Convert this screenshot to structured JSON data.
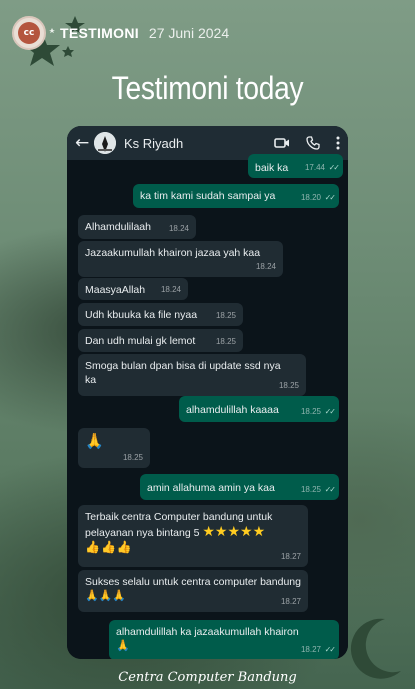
{
  "story": {
    "account_name": "TESTIMONI",
    "date": "27 Juni 2024",
    "title": "Testimoni today",
    "caption": "Centra Computer Bandung"
  },
  "chat": {
    "contact_name": "Ks Riyadh",
    "header_icons": [
      "back-arrow-icon",
      "video-call-icon",
      "phone-icon",
      "more-options-icon"
    ],
    "messages": [
      {
        "dir": "out",
        "text": "baik ka",
        "time": "17.44"
      },
      {
        "dir": "out",
        "text": "ka tim kami sudah sampai ya",
        "time": "18.20"
      },
      {
        "dir": "in",
        "text": "Alhamdulilaah",
        "time": "18.24"
      },
      {
        "dir": "in",
        "text": "Jazaakumullah khairon jazaa yah kaa",
        "time": "18.24"
      },
      {
        "dir": "in",
        "text": "MaasyaAllah",
        "time": "18.24"
      },
      {
        "dir": "in",
        "text": "Udh kbuuka ka file nyaa",
        "time": "18.25"
      },
      {
        "dir": "in",
        "text": "Dan udh mulai gk lemot",
        "time": "18.25"
      },
      {
        "dir": "in",
        "text": "Smoga bulan dpan bisa di update ssd nya ka",
        "time": "18.25"
      },
      {
        "dir": "out",
        "text": "alhamdulillah kaaaa",
        "time": "18.25"
      },
      {
        "dir": "in",
        "text": "🙏",
        "time": "18.25"
      },
      {
        "dir": "out",
        "text": "amin allahuma amin ya kaa",
        "time": "18.25"
      },
      {
        "dir": "in",
        "text": "Terbaik centra Computer bandung untuk pelayanan nya bintang 5",
        "stars": "★★★★★",
        "emoji": "👍👍👍",
        "time": "18.27"
      },
      {
        "dir": "in",
        "text": "Sukses selalu untuk centra computer bandung",
        "emoji": "🙏🙏🙏",
        "time": "18.27"
      },
      {
        "dir": "out",
        "text": "alhamdulillah ka jazaakumullah khairon",
        "emoji": "🙏",
        "time": "18.27"
      }
    ]
  },
  "colors": {
    "incoming_bubble": "#202c33",
    "outgoing_bubble": "#005c4b",
    "chat_background": "#0b141a",
    "header_background": "#1f2c34",
    "read_ticks": "#a7d7cc"
  }
}
